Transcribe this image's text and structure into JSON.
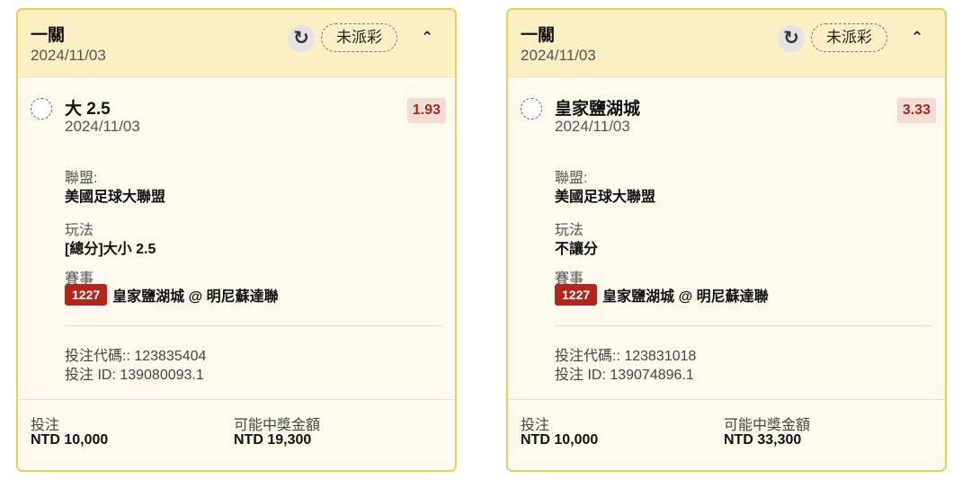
{
  "cards": [
    {
      "header": {
        "title": "一關",
        "date": "2024/11/03",
        "refresh_icon": "↻",
        "status": "未派彩",
        "chevron": "⌃"
      },
      "selection": {
        "name": "大 2.5",
        "date": "2024/11/03",
        "odds": "1.93"
      },
      "league": {
        "label": "聯盟:",
        "value": "美國足球大聯盟"
      },
      "market": {
        "label": "玩法",
        "value": "[總分]大小 2.5"
      },
      "event": {
        "label": "賽事",
        "id": "1227",
        "name": "皇家鹽湖城 @ 明尼蘇達聯"
      },
      "bet_code": "投注代碼:: 123835404",
      "bet_id": "投注 ID: 139080093.1",
      "footer": {
        "stake_label": "投注",
        "stake_value": "NTD 10,000",
        "payout_label": "可能中獎金額",
        "payout_value": "NTD 19,300"
      }
    },
    {
      "header": {
        "title": "一關",
        "date": "2024/11/03",
        "refresh_icon": "↻",
        "status": "未派彩",
        "chevron": "⌃"
      },
      "selection": {
        "name": "皇家鹽湖城",
        "date": "2024/11/03",
        "odds": "3.33"
      },
      "league": {
        "label": "聯盟:",
        "value": "美國足球大聯盟"
      },
      "market": {
        "label": "玩法",
        "value": "不讓分"
      },
      "event": {
        "label": "賽事",
        "id": "1227",
        "name": "皇家鹽湖城 @ 明尼蘇達聯"
      },
      "bet_code": "投注代碼:: 123831018",
      "bet_id": "投注 ID: 139074896.1",
      "footer": {
        "stake_label": "投注",
        "stake_value": "NTD 10,000",
        "payout_label": "可能中獎金額",
        "payout_value": "NTD 33,300"
      }
    }
  ],
  "colors": {
    "card_border": "#f0cd4a",
    "header_bg": "#fbefc4",
    "odds_bg": "#f4dcd6",
    "odds_text": "#a22a1f",
    "event_id_bg": "#b3261e"
  },
  "icons": {
    "refresh": "refresh-icon",
    "collapse": "chevron-up-icon",
    "select": "radio-circle-icon"
  }
}
